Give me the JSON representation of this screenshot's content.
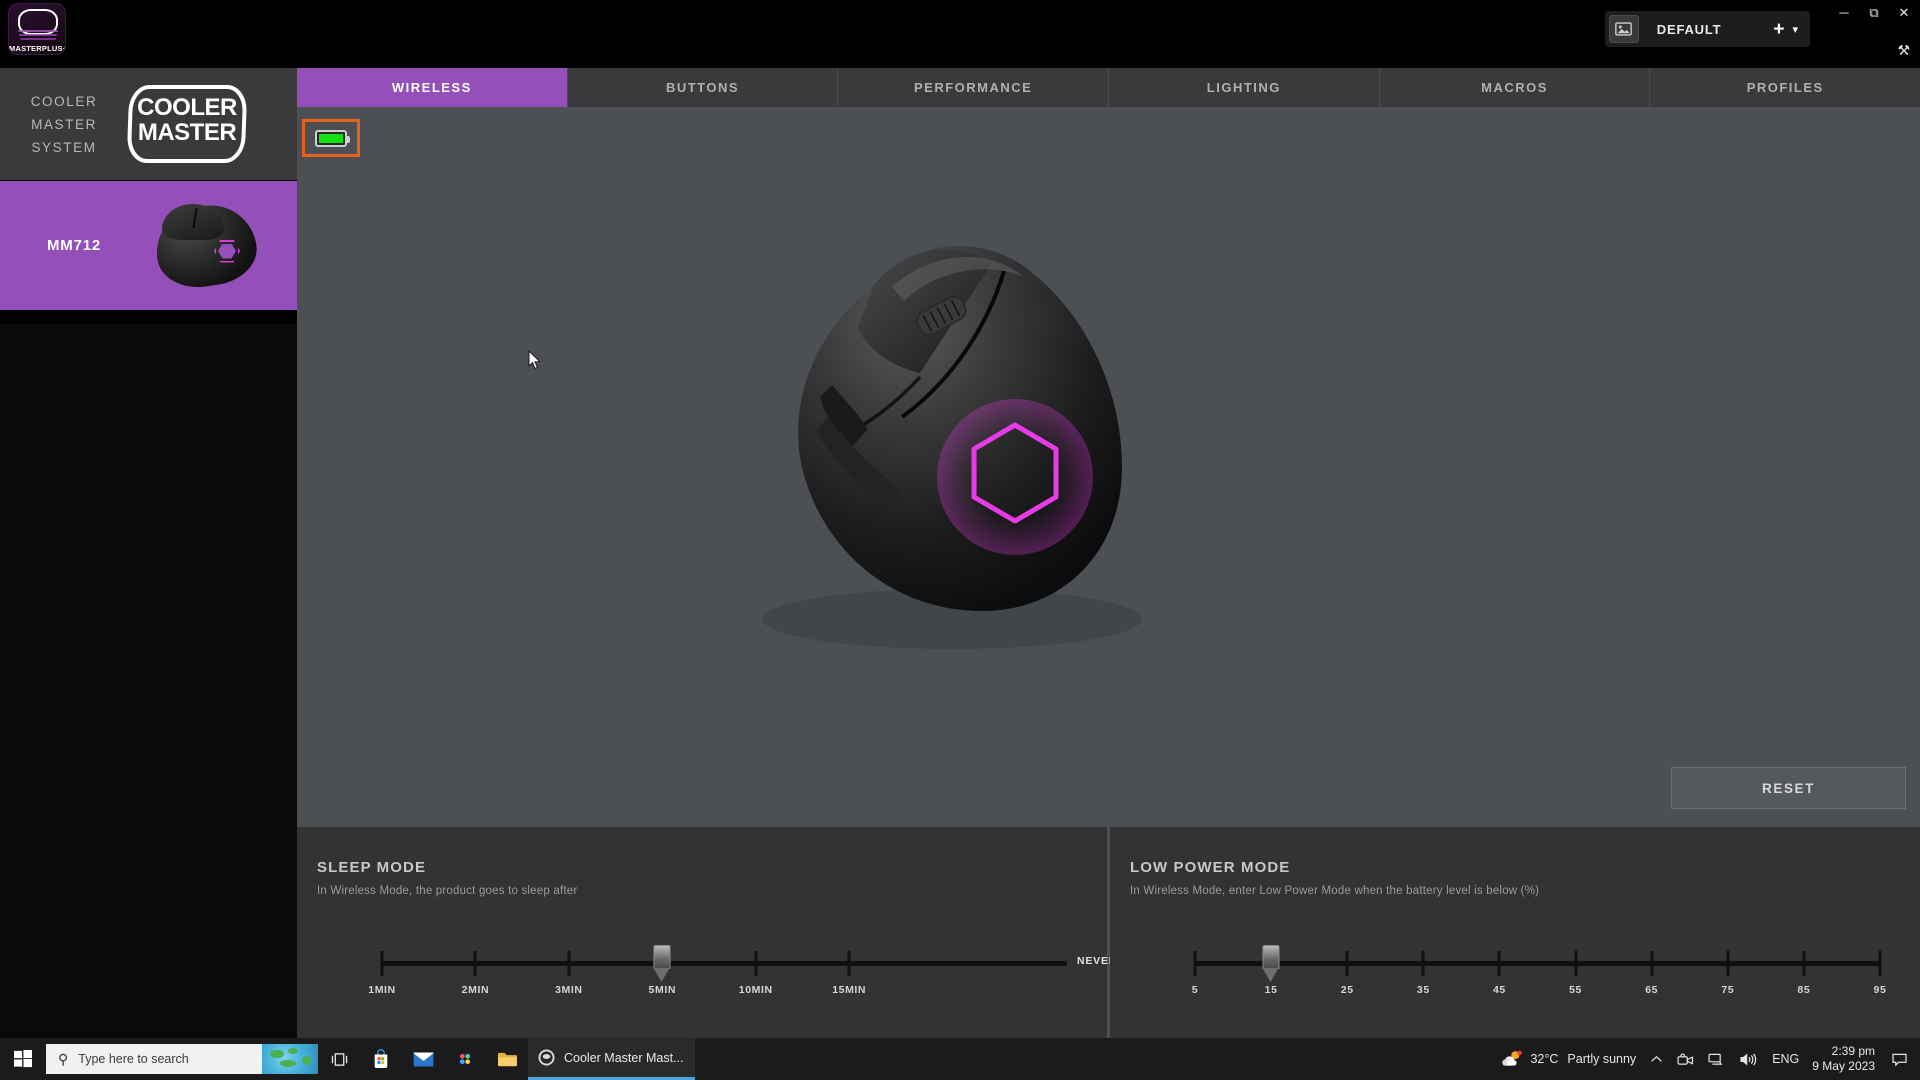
{
  "app": {
    "brand": "MASTERPLUS",
    "brand_suffix": "+",
    "window_title": "Cooler Master MasterPlus+"
  },
  "titlebar": {
    "profile": {
      "image_icon": "image-icon",
      "name": "DEFAULT",
      "add_label": "+",
      "chevron": "⌄"
    },
    "window_controls": {
      "minimize": "—",
      "restore": "❐",
      "close": "✕",
      "tools": "⚒"
    }
  },
  "sidebar": {
    "system_label_line1": "COOLER MASTER",
    "system_label_line2": "SYSTEM",
    "logo_line1": "COOLER",
    "logo_line2": "MASTER",
    "devices": [
      {
        "name": "MM712",
        "selected": true
      }
    ]
  },
  "tabs": [
    {
      "label": "WIRELESS",
      "active": true
    },
    {
      "label": "BUTTONS",
      "active": false
    },
    {
      "label": "PERFORMANCE",
      "active": false
    },
    {
      "label": "LIGHTING",
      "active": false
    },
    {
      "label": "MACROS",
      "active": false
    },
    {
      "label": "PROFILES",
      "active": false
    }
  ],
  "stage": {
    "battery": {
      "icon": "battery-icon",
      "level_percent": 100,
      "highlighted": true
    },
    "reset_label": "RESET"
  },
  "panels": {
    "sleep_mode": {
      "title": "SLEEP MODE",
      "subtitle": "In Wireless Mode, the product goes to sleep after",
      "ticks": [
        "1MIN",
        "2MIN",
        "3MIN",
        "5MIN",
        "10MIN",
        "15MIN"
      ],
      "end_label": "NEVER",
      "value": "5MIN",
      "value_index": 3
    },
    "low_power_mode": {
      "title": "LOW POWER MODE",
      "subtitle": "In Wireless Mode, enter Low Power Mode when the battery level is below (%)",
      "ticks": [
        "5",
        "15",
        "25",
        "35",
        "45",
        "55",
        "65",
        "75",
        "85",
        "95"
      ],
      "value": "15",
      "value_index": 1
    }
  },
  "taskbar": {
    "start_icon": "windows-start-icon",
    "search_placeholder": "Type here to search",
    "search_icon": "search-icon",
    "icons": [
      {
        "name": "task-view-icon"
      },
      {
        "name": "microsoft-store-icon"
      },
      {
        "name": "mail-icon"
      },
      {
        "name": "photos-icon"
      },
      {
        "name": "file-explorer-icon"
      }
    ],
    "active_window": "Cooler Master Mast...",
    "weather": {
      "temperature": "32°C",
      "condition": "Partly sunny",
      "icon": "partly-sunny-icon"
    },
    "tray": [
      {
        "name": "show-hidden-icons-chevron"
      },
      {
        "name": "camera-icon"
      },
      {
        "name": "network-icon"
      },
      {
        "name": "volume-icon"
      }
    ],
    "language": "ENG",
    "time": "2:39 pm",
    "date": "9 May 2023",
    "notification_icon": "notification-icon"
  },
  "colors": {
    "accent_purple": "#9450b8",
    "highlight_orange": "#e8601c",
    "battery_green": "#11e011",
    "rgb_logo_magenta": "#e63be6",
    "stage_bg": "#4c5055",
    "panel_bg": "#333333"
  }
}
